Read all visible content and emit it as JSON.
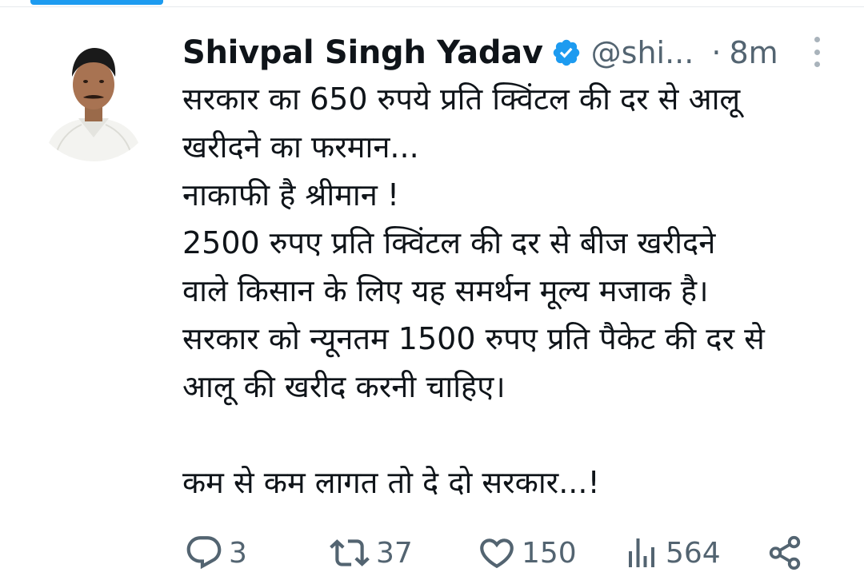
{
  "tweet": {
    "author_name": "Shivpal Singh Yadav",
    "handle": "@shi...",
    "separator": "·",
    "time": "8m",
    "body_lines": [
      "सरकार का 650 रुपये प्रति क्विंटल की दर से आलू",
      "खरीदने का फरमान...",
      "नाकाफी है श्रीमान !",
      "2500 रुपए प्रति क्विंटल की दर से बीज खरीदने",
      "वाले किसान के लिए यह समर्थन मूल्य मजाक है।",
      "सरकार को न्यूनतम 1500 रुपए प्रति पैकेट की दर से",
      "आलू की खरीद करनी चाहिए।",
      "",
      "कम से कम लागत तो दे दो सरकार...!"
    ]
  },
  "actions": {
    "replies": "3",
    "reposts": "37",
    "likes": "150",
    "views": "564"
  },
  "icons": {
    "verified": "verified-badge-icon",
    "more": "more-vertical-icon",
    "reply": "reply-icon",
    "repost": "repost-icon",
    "like": "heart-icon",
    "views": "views-bar-chart-icon",
    "share": "share-icon"
  },
  "colors": {
    "accent": "#1d9bf0",
    "text": "#0f1419",
    "secondary": "#536471"
  }
}
